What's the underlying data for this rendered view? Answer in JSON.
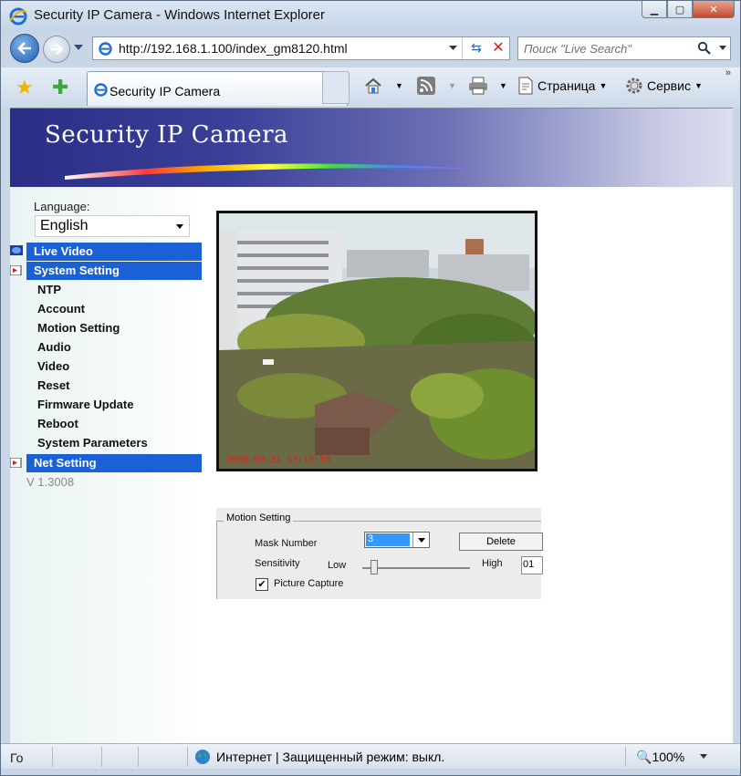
{
  "window": {
    "title": "Security IP Camera - Windows Internet Explorer"
  },
  "address": {
    "url": "http://192.168.1.100/index_gm8120.html"
  },
  "search": {
    "placeholder": "Поиск \"Live Search\""
  },
  "tabs": [
    {
      "label": "Security IP Camera"
    }
  ],
  "commands": {
    "page": "Страница",
    "tools": "Сервис"
  },
  "banner": {
    "title": "Security IP Camera"
  },
  "sidebar": {
    "language_label": "Language:",
    "language_value": "English",
    "menu": {
      "live_video": "Live Video",
      "system_setting": "System Setting",
      "net_setting": "Net Setting"
    },
    "submenu": [
      "NTP",
      "Account",
      "Motion Setting",
      "Audio",
      "Video",
      "Reset",
      "Firmware Update",
      "Reboot",
      "System Parameters"
    ],
    "version": "V 1.3008"
  },
  "camera": {
    "timestamp": "2008-09-21 17:10:50"
  },
  "motion": {
    "legend": "Motion Setting",
    "mask_label": "Mask Number",
    "mask_value": "3",
    "delete_label": "Delete",
    "sensitivity_label": "Sensitivity",
    "low_label": "Low",
    "high_label": "High",
    "sensitivity_value": "01",
    "capture_label": "Picture Capture",
    "capture_checked": true
  },
  "status": {
    "left": "Го",
    "zone": "Интернет | Защищенный режим: выкл.",
    "zoom": "100%"
  }
}
